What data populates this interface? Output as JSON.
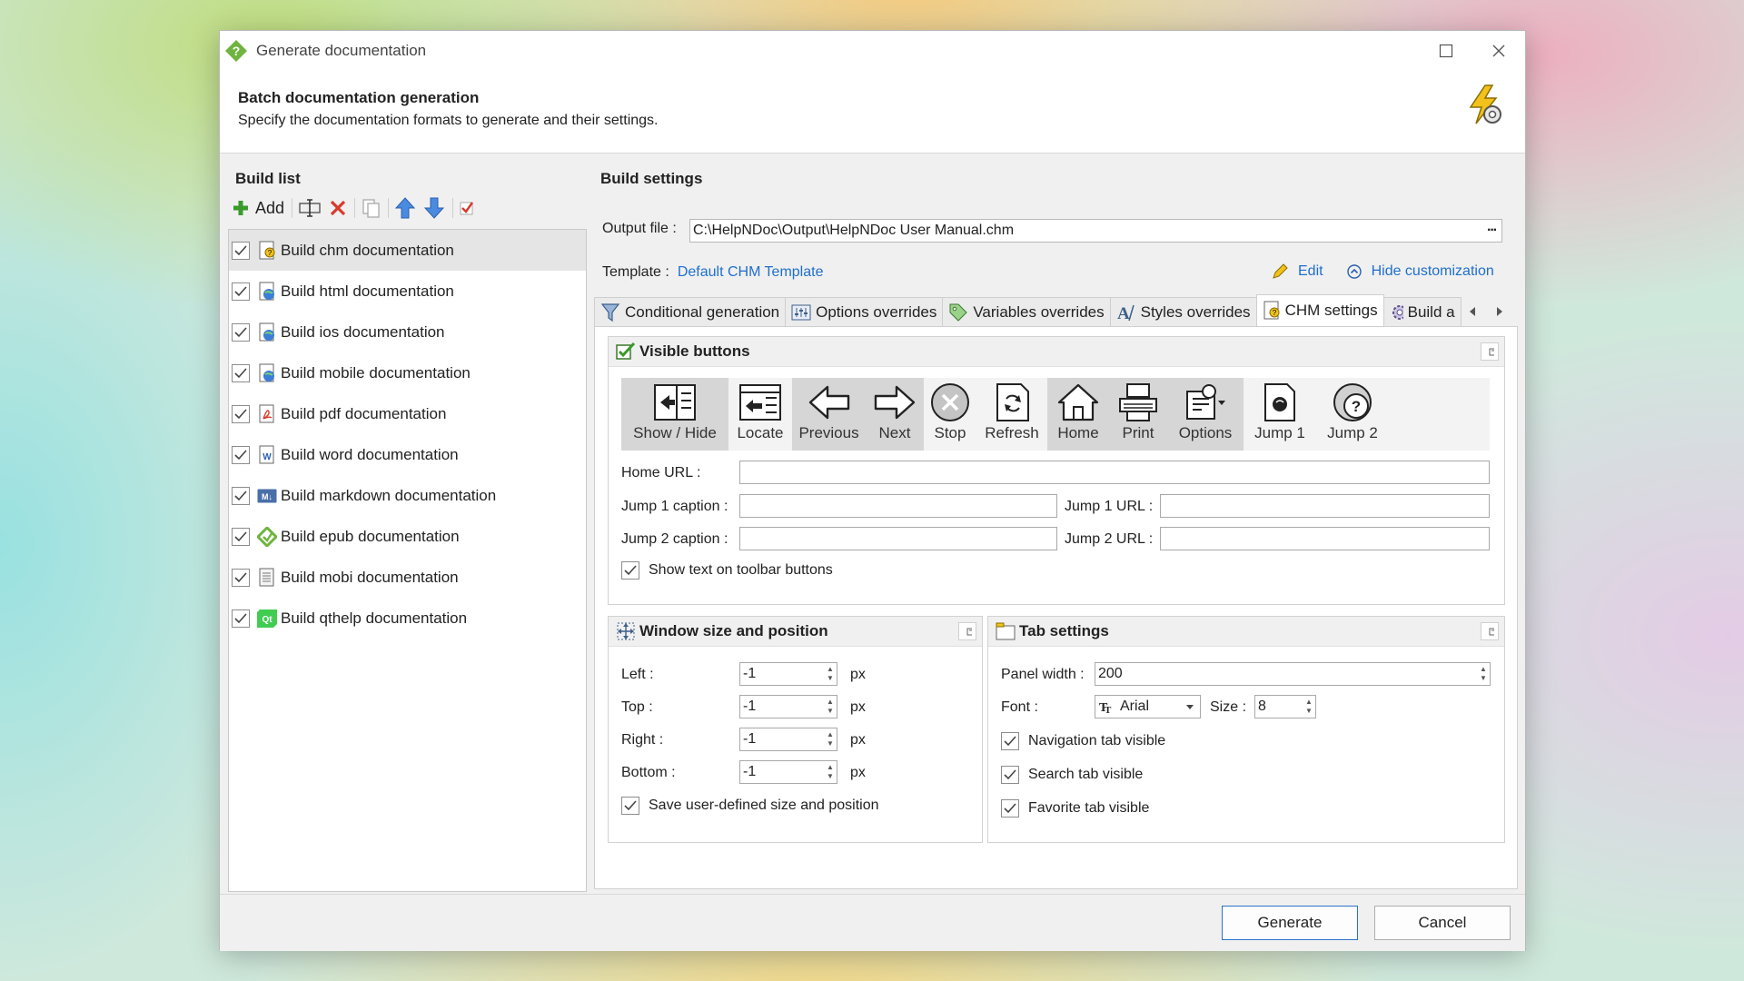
{
  "window": {
    "title": "Generate documentation"
  },
  "header": {
    "title": "Batch documentation generation",
    "subtitle": "Specify the documentation formats to generate and their settings."
  },
  "build_list": {
    "heading": "Build list",
    "add_label": "Add",
    "items": [
      {
        "label": "Build chm documentation",
        "checked": true,
        "selected": true
      },
      {
        "label": "Build html documentation",
        "checked": true
      },
      {
        "label": "Build ios documentation",
        "checked": true
      },
      {
        "label": "Build mobile documentation",
        "checked": true
      },
      {
        "label": "Build pdf documentation",
        "checked": true
      },
      {
        "label": "Build word documentation",
        "checked": true
      },
      {
        "label": "Build markdown documentation",
        "checked": true
      },
      {
        "label": "Build epub documentation",
        "checked": true
      },
      {
        "label": "Build mobi documentation",
        "checked": true
      },
      {
        "label": "Build qthelp documentation",
        "checked": true
      }
    ]
  },
  "build_settings": {
    "heading": "Build settings",
    "output_label": "Output file :",
    "output_value": "C:\\HelpNDoc\\Output\\HelpNDoc User Manual.chm",
    "browse": "···",
    "template_label": "Template :",
    "template_value": "Default CHM Template",
    "edit_label": "Edit",
    "hide_label": "Hide customization"
  },
  "tabs": [
    "Conditional generation",
    "Options overrides",
    "Variables overrides",
    "Styles overrides",
    "CHM settings",
    "Build a"
  ],
  "visible_buttons": {
    "heading": "Visible buttons",
    "buttons": [
      {
        "label": "Show / Hide",
        "on": true
      },
      {
        "label": "Locate",
        "on": false
      },
      {
        "label": "Previous",
        "on": true
      },
      {
        "label": "Next",
        "on": true
      },
      {
        "label": "Stop",
        "on": false
      },
      {
        "label": "Refresh",
        "on": false
      },
      {
        "label": "Home",
        "on": true
      },
      {
        "label": "Print",
        "on": true
      },
      {
        "label": "Options",
        "on": true
      },
      {
        "label": "Jump 1",
        "on": false
      },
      {
        "label": "Jump 2",
        "on": false
      }
    ],
    "home_url_label": "Home URL :",
    "jump1_caption_label": "Jump 1 caption :",
    "jump1_url_label": "Jump 1 URL :",
    "jump2_caption_label": "Jump 2 caption :",
    "jump2_url_label": "Jump 2 URL :",
    "show_text_label": "Show text on toolbar buttons"
  },
  "window_size": {
    "heading": "Window size and position",
    "left_label": "Left :",
    "left_value": "-1",
    "top_label": "Top :",
    "top_value": "-1",
    "right_label": "Right :",
    "right_value": "-1",
    "bottom_label": "Bottom :",
    "bottom_value": "-1",
    "unit": "px",
    "save_label": "Save user-defined size and position"
  },
  "tab_settings": {
    "heading": "Tab settings",
    "panel_width_label": "Panel width :",
    "panel_width_value": "200",
    "font_label": "Font :",
    "font_value": "Arial",
    "size_label": "Size :",
    "size_value": "8",
    "nav_label": "Navigation tab visible",
    "search_label": "Search tab visible",
    "fav_label": "Favorite tab visible"
  },
  "footer": {
    "generate": "Generate",
    "cancel": "Cancel"
  }
}
